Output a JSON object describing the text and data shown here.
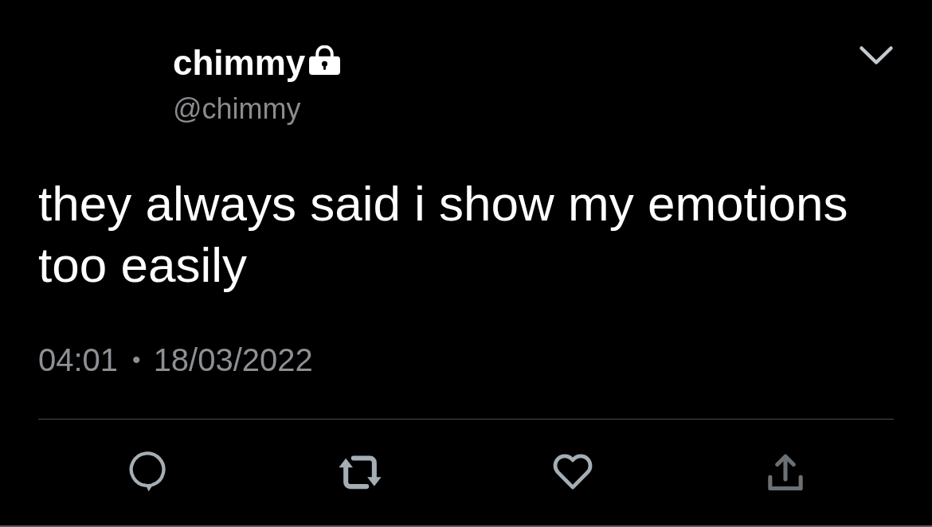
{
  "author": {
    "display_name": "chimmy",
    "protected": true,
    "handle": "@chimmy"
  },
  "tweet": {
    "text": "they always said i show my emotions too easily"
  },
  "timestamp": {
    "time": "04:01",
    "separator": "•",
    "date": "18/03/2022"
  },
  "actions": [
    {
      "kind": "reply"
    },
    {
      "kind": "retweet"
    },
    {
      "kind": "like"
    },
    {
      "kind": "share"
    }
  ]
}
